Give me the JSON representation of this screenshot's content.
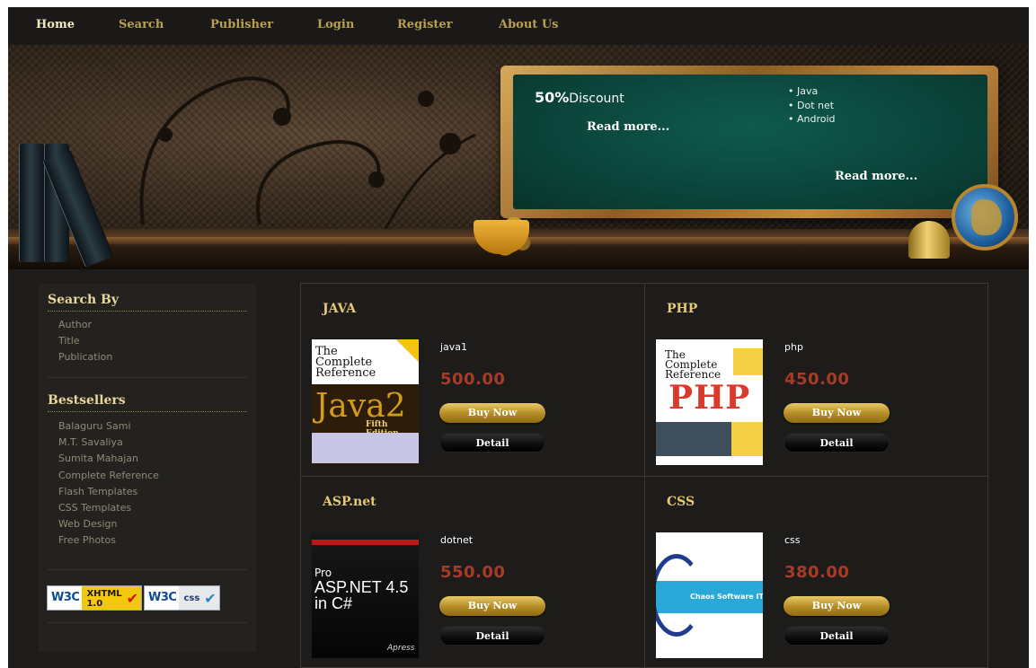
{
  "nav": {
    "items": [
      "Home",
      "Search",
      "Publisher",
      "Login",
      "Register",
      "About Us"
    ],
    "active": "Home"
  },
  "banner": {
    "discount_percent": "50%",
    "discount_word": "Discount",
    "read_more_left": "Read more...",
    "read_more_right": "Read more...",
    "list": [
      "Java",
      "Dot net",
      "Android"
    ]
  },
  "sidebar": {
    "search_heading": "Search By",
    "search_items": [
      "Author",
      "Title",
      "Publication"
    ],
    "bestsellers_heading": "Bestsellers",
    "bestsellers_items": [
      "Balaguru Sami",
      "M.T. Savaliya",
      "Sumita Mahajan",
      "Complete Reference",
      "Flash Templates",
      "CSS Templates",
      "Web Design",
      "Free Photos"
    ],
    "badge_xhtml": {
      "w3c": "W3C",
      "kind_line1": "XHTML",
      "kind_line2": "1.0",
      "check": "✔"
    },
    "badge_css": {
      "w3c": "W3C",
      "kind": "css",
      "check": "✔"
    }
  },
  "products": [
    {
      "category": "JAVA",
      "name": "java1",
      "price": "500.00",
      "buy_label": "Buy Now",
      "detail_label": "Detail",
      "cover": {
        "line1": "The",
        "line2": "Complete",
        "line3": "Reference",
        "big": "Java2",
        "edition": "Fifth Edition"
      }
    },
    {
      "category": "PHP",
      "name": "php",
      "price": "450.00",
      "buy_label": "Buy Now",
      "detail_label": "Detail",
      "cover": {
        "line1": "The",
        "line2": "Complete",
        "line3": "Reference",
        "big": "PHP"
      }
    },
    {
      "category": "ASP.net",
      "name": "dotnet",
      "price": "550.00",
      "buy_label": "Buy Now",
      "detail_label": "Detail",
      "cover": {
        "pro": "Pro",
        "line1": "ASP.NET 4.5",
        "line2": "in C#",
        "publisher": "Apress"
      }
    },
    {
      "category": "CSS",
      "name": "css",
      "price": "380.00",
      "buy_label": "Buy Now",
      "detail_label": "Detail",
      "cover": {
        "band_text": "Chaos Software IT Pvt. Ltd."
      }
    }
  ],
  "colors": {
    "background": "#1d1c1a",
    "accent_gold": "#e5c873",
    "price_red": "#a73b28",
    "board_green": "#0a4037"
  }
}
